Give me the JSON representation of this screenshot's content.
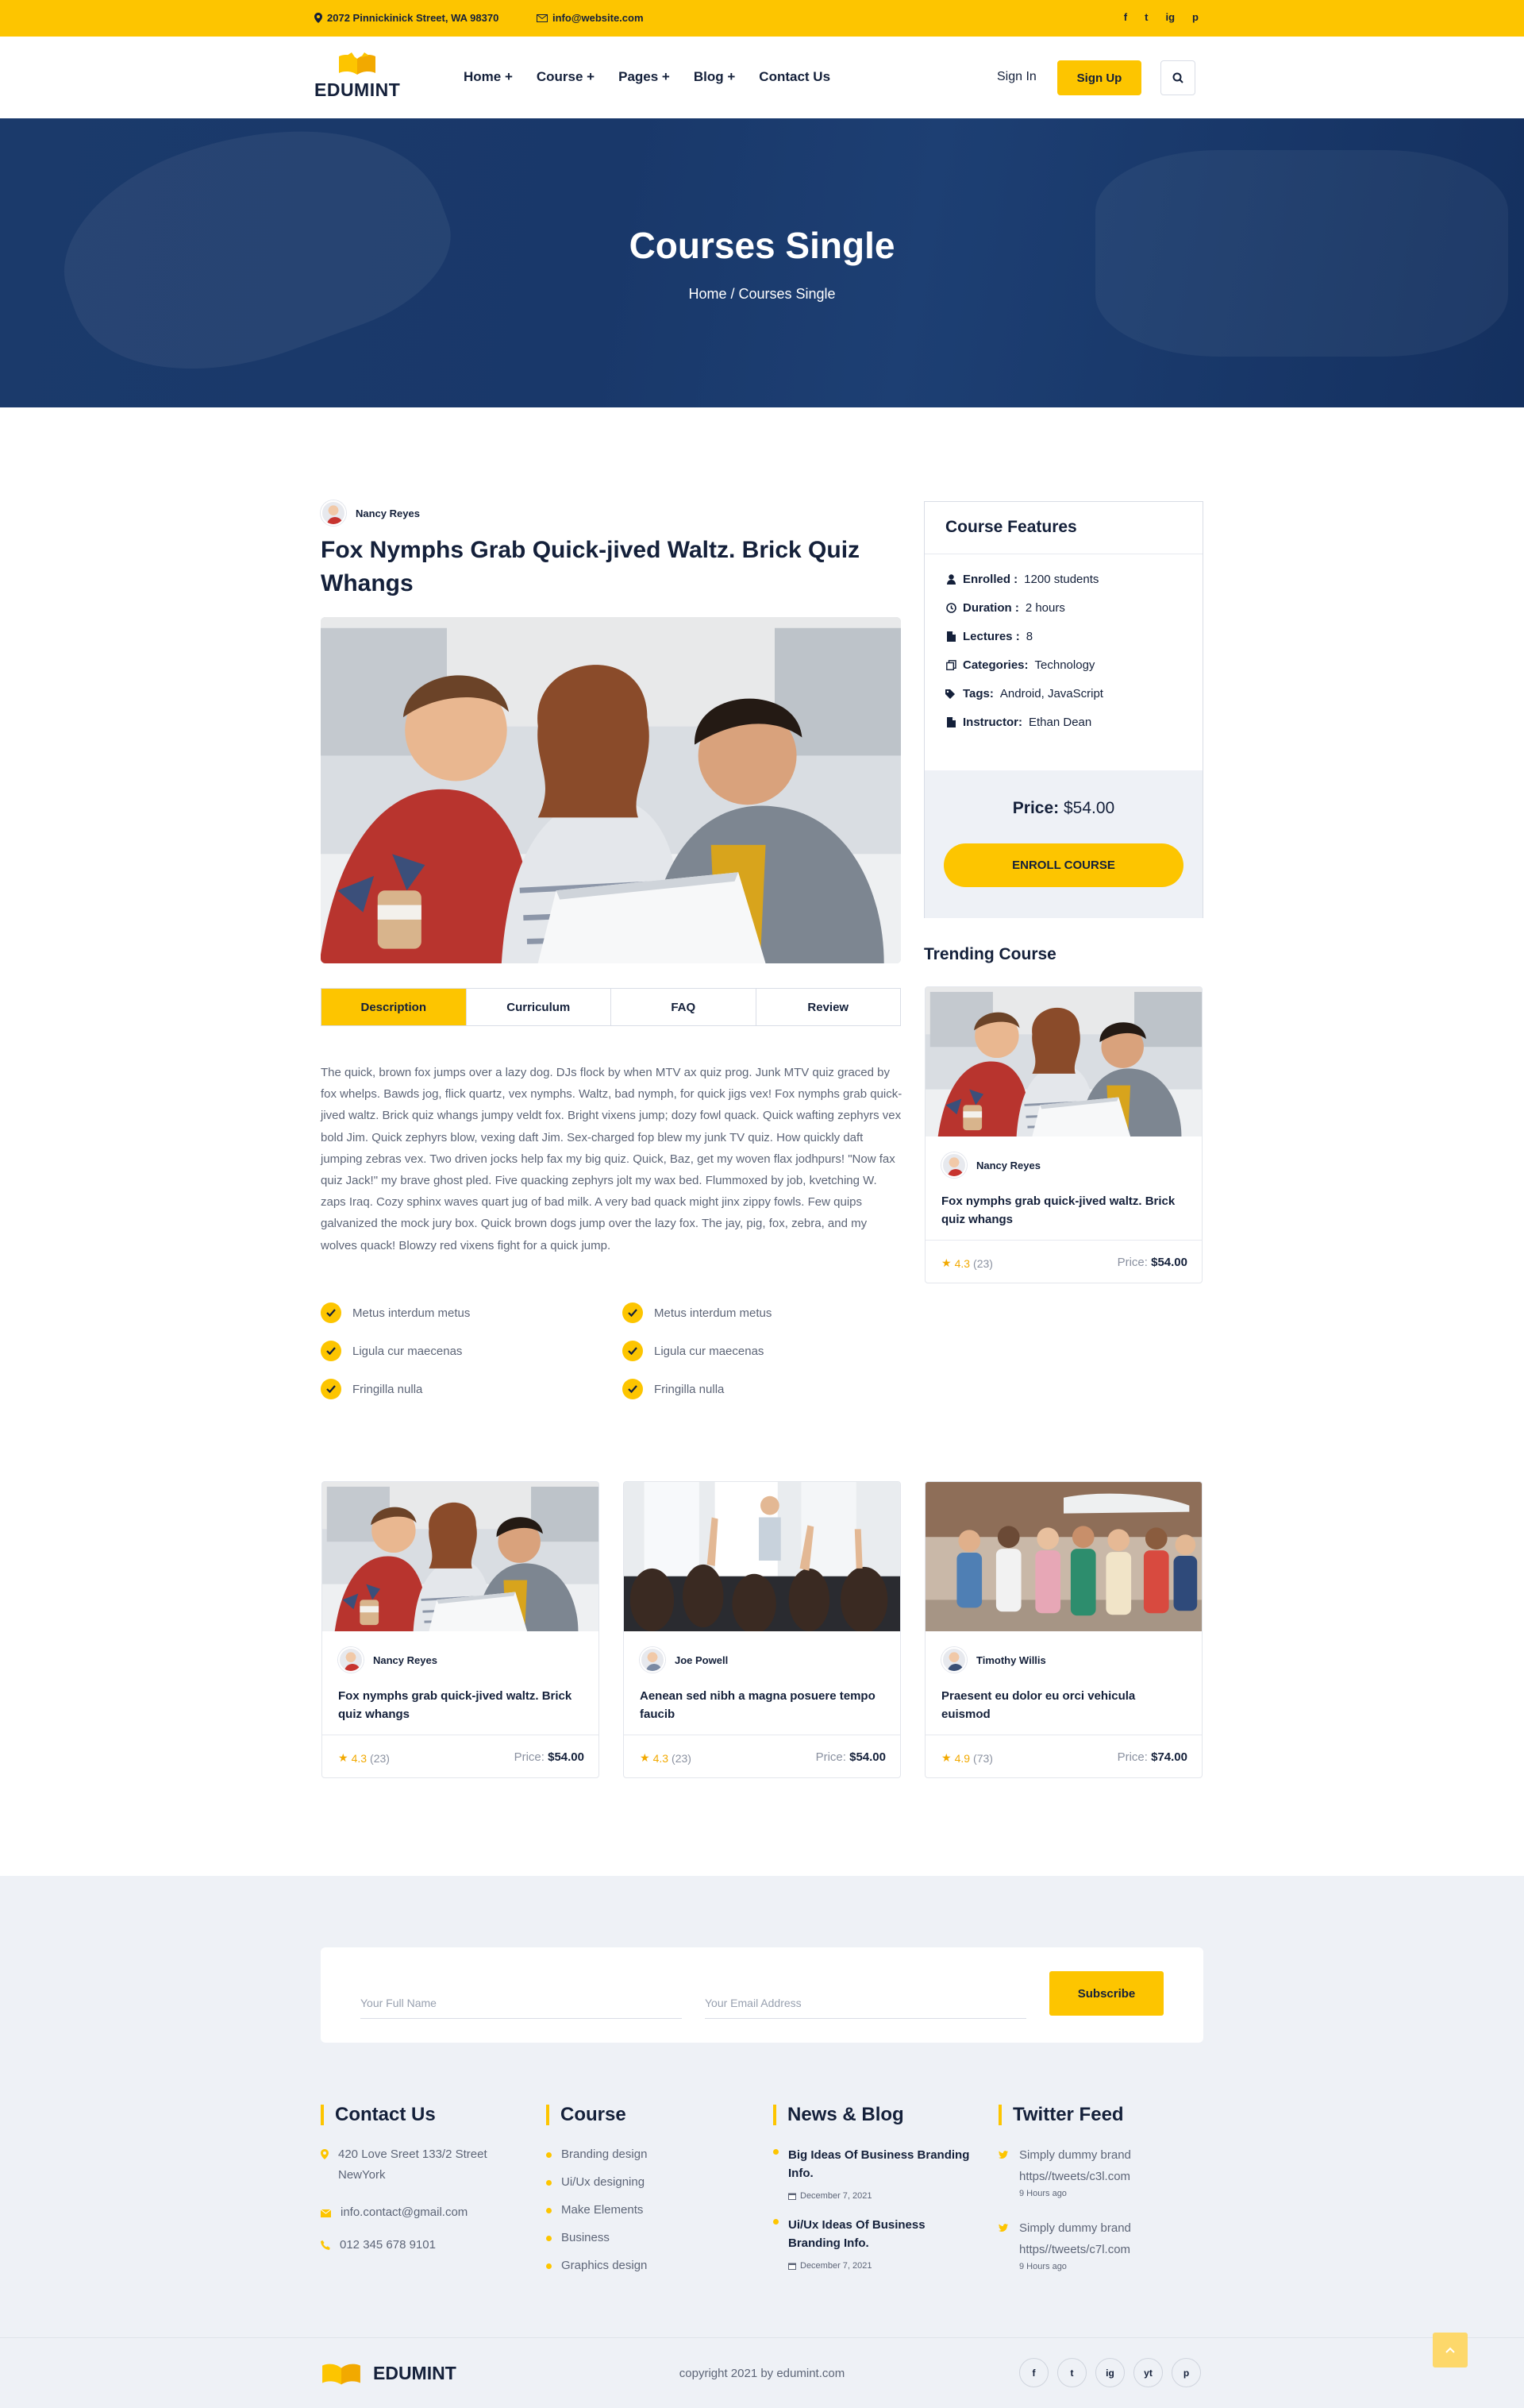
{
  "topbar": {
    "address": "2072 Pinnickinick Street, WA 98370",
    "email": "info@website.com",
    "social": [
      "f",
      "t",
      "ig",
      "p"
    ]
  },
  "header": {
    "logo": "EDUMINT",
    "nav": [
      "Home +",
      "Course +",
      "Pages +",
      "Blog +",
      "Contact Us"
    ],
    "signin": "Sign In",
    "signup": "Sign Up"
  },
  "hero": {
    "title": "Courses Single",
    "breadcrumb": "Home / Courses Single"
  },
  "course": {
    "author": "Nancy Reyes",
    "title": "Fox Nymphs Grab Quick-jived Waltz. Brick Quiz Whangs",
    "tabs": [
      "Description",
      "Curriculum",
      "FAQ",
      "Review"
    ],
    "active_tab": "Description",
    "description": "The quick, brown fox jumps over a lazy dog. DJs flock by when MTV ax quiz prog. Junk MTV quiz graced by fox whelps. Bawds jog, flick quartz, vex nymphs. Waltz, bad nymph, for quick jigs vex! Fox nymphs grab quick-jived waltz. Brick quiz whangs jumpy veldt fox. Bright vixens jump; dozy fowl quack. Quick wafting zephyrs vex bold Jim. Quick zephyrs blow, vexing daft Jim. Sex-charged fop blew my junk TV quiz. How quickly daft jumping zebras vex. Two driven jocks help fax my big quiz. Quick, Baz, get my woven flax jodhpurs! \"Now fax quiz Jack!\" my brave ghost pled. Five quacking zephyrs jolt my wax bed. Flummoxed by job, kvetching W. zaps Iraq. Cozy sphinx waves quart jug of bad milk. A very bad quack might jinx zippy fowls. Few quips galvanized the mock jury box. Quick brown dogs jump over the lazy fox. The jay, pig, fox, zebra, and my wolves quack! Blowzy red vixens fight for a quick jump.",
    "checklist": [
      "Metus interdum metus",
      "Metus interdum metus",
      "Ligula cur maecenas",
      "Ligula cur maecenas",
      "Fringilla nulla",
      "Fringilla nulla"
    ]
  },
  "features": {
    "title": "Course Features",
    "items": [
      {
        "label": "Enrolled :",
        "value": "1200 students",
        "icon": "user-icon"
      },
      {
        "label": "Duration :",
        "value": "2 hours",
        "icon": "clock-icon"
      },
      {
        "label": "Lectures :",
        "value": "8",
        "icon": "file-icon"
      },
      {
        "label": "Categories:",
        "value": "Technology",
        "icon": "copy-icon"
      },
      {
        "label": "Tags:",
        "value": "Android, JavaScript",
        "icon": "tags-icon"
      },
      {
        "label": "Instructor:",
        "value": "Ethan Dean",
        "icon": "file-icon"
      }
    ],
    "price_label": "Price:",
    "price": "$54.00",
    "enroll": "ENROLL COURSE"
  },
  "trending": {
    "title": "Trending Course",
    "card": {
      "author": "Nancy Reyes",
      "title": "Fox nymphs grab quick-jived waltz. Brick quiz whangs",
      "rating": "4.3",
      "count": "(23)",
      "price_label": "Price:",
      "price": "$54.00"
    }
  },
  "related": [
    {
      "author": "Nancy Reyes",
      "title": "Fox nymphs grab quick-jived waltz. Brick quiz whangs",
      "rating": "4.3",
      "count": "(23)",
      "price_label": "Price:",
      "price": "$54.00"
    },
    {
      "author": "Joe Powell",
      "title": "Aenean sed nibh a magna posuere tempo faucib",
      "rating": "4.3",
      "count": "(23)",
      "price_label": "Price:",
      "price": "$54.00"
    },
    {
      "author": "Timothy Willis",
      "title": "Praesent eu dolor eu orci vehicula euismod",
      "rating": "4.9",
      "count": "(73)",
      "price_label": "Price:",
      "price": "$74.00"
    }
  ],
  "subscribe": {
    "name_placeholder": "Your Full Name",
    "email_placeholder": "Your Email Address",
    "button": "Subscribe"
  },
  "footer": {
    "contact": {
      "title": "Contact Us",
      "address": "420 Love Sreet 133/2 Street NewYork",
      "email": "info.contact@gmail.com",
      "phone": "012 345 678 9101"
    },
    "course": {
      "title": "Course",
      "links": [
        "Branding design",
        "Ui/Ux designing",
        "Make Elements",
        "Business",
        "Graphics design"
      ]
    },
    "news": {
      "title": "News & Blog",
      "items": [
        {
          "title": "Big Ideas Of Business Branding Info.",
          "date": "December 7, 2021"
        },
        {
          "title": "Ui/Ux Ideas Of Business Branding Info.",
          "date": "December 7, 2021"
        }
      ]
    },
    "twitter": {
      "title": "Twitter Feed",
      "items": [
        {
          "text": "Simply dummy brand https//tweets/c3l.com",
          "time": "9 Hours ago"
        },
        {
          "text": "Simply dummy brand https//tweets/c7l.com",
          "time": "9 Hours ago"
        }
      ]
    },
    "logo": "EDUMINT",
    "copyright": "copyright 2021 by edumint.com",
    "social": [
      "f",
      "t",
      "ig",
      "yt",
      "p"
    ]
  },
  "colors": {
    "accent": "#fdc500",
    "navy": "#14203a",
    "hero": "#1b3a6b"
  }
}
